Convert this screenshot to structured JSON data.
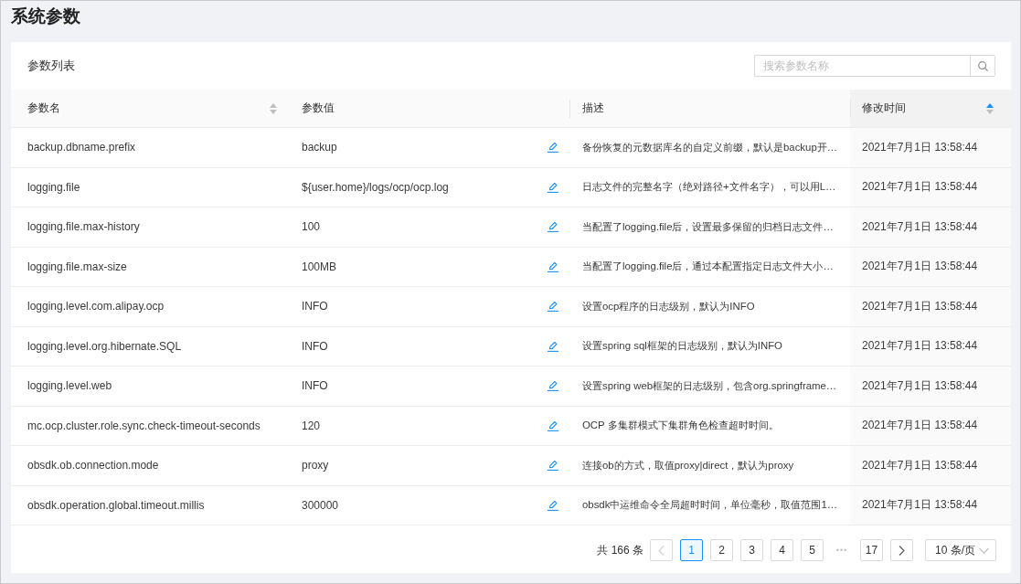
{
  "page": {
    "title": "系统参数"
  },
  "card": {
    "title": "参数列表",
    "search": {
      "placeholder": "搜索参数名称"
    }
  },
  "table": {
    "columns": [
      {
        "label": "参数名",
        "sortable": true,
        "sorted": false
      },
      {
        "label": "参数值",
        "sortable": false
      },
      {
        "label": "描述",
        "sortable": false
      },
      {
        "label": "修改时间",
        "sortable": true,
        "sorted": true
      }
    ],
    "rows": [
      {
        "name": "backup.dbname.prefix",
        "value": "backup",
        "description": "备份恢复的元数据库名的自定义前缀，默认是backup开…",
        "modified": "2021年7月1日 13:58:44"
      },
      {
        "name": "logging.file",
        "value": "${user.home}/logs/ocp/ocp.log",
        "description": "日志文件的完整名字（绝对路径+文件名字），可以用L…",
        "modified": "2021年7月1日 13:58:44"
      },
      {
        "name": "logging.file.max-history",
        "value": "100",
        "description": "当配置了logging.file后，设置最多保留的归档日志文件…",
        "modified": "2021年7月1日 13:58:44"
      },
      {
        "name": "logging.file.max-size",
        "value": "100MB",
        "description": "当配置了logging.file后，通过本配置指定日志文件大小…",
        "modified": "2021年7月1日 13:58:44"
      },
      {
        "name": "logging.level.com.alipay.ocp",
        "value": "INFO",
        "description": "设置ocp程序的日志级别，默认为INFO",
        "modified": "2021年7月1日 13:58:44"
      },
      {
        "name": "logging.level.org.hibernate.SQL",
        "value": "INFO",
        "description": "设置spring sql框架的日志级别，默认为INFO",
        "modified": "2021年7月1日 13:58:44"
      },
      {
        "name": "logging.level.web",
        "value": "INFO",
        "description": "设置spring web框架的日志级别，包含org.springframe…",
        "modified": "2021年7月1日 13:58:44"
      },
      {
        "name": "mc.ocp.cluster.role.sync.check-timeout-seconds",
        "value": "120",
        "description": "OCP 多集群模式下集群角色检查超时时间。",
        "modified": "2021年7月1日 13:58:44"
      },
      {
        "name": "obsdk.ob.connection.mode",
        "value": "proxy",
        "description": "连接ob的方式，取值proxy|direct，默认为proxy",
        "modified": "2021年7月1日 13:58:44"
      },
      {
        "name": "obsdk.operation.global.timeout.millis",
        "value": "300000",
        "description": "obsdk中运维命令全局超时时间，单位毫秒，取值范围1…",
        "modified": "2021年7月1日 13:58:44"
      }
    ]
  },
  "pagination": {
    "total": "共 166 条",
    "prev_disabled": true,
    "next_disabled": false,
    "pages": [
      {
        "kind": "page",
        "label": "1",
        "selected": true
      },
      {
        "kind": "page",
        "label": "2",
        "selected": false
      },
      {
        "kind": "page",
        "label": "3",
        "selected": false
      },
      {
        "kind": "page",
        "label": "4",
        "selected": false
      },
      {
        "kind": "page",
        "label": "5",
        "selected": false
      },
      {
        "kind": "ellipsis",
        "label": "•••",
        "selected": false
      },
      {
        "kind": "page",
        "label": "17",
        "selected": false
      }
    ],
    "page_size": "10 条/页"
  }
}
